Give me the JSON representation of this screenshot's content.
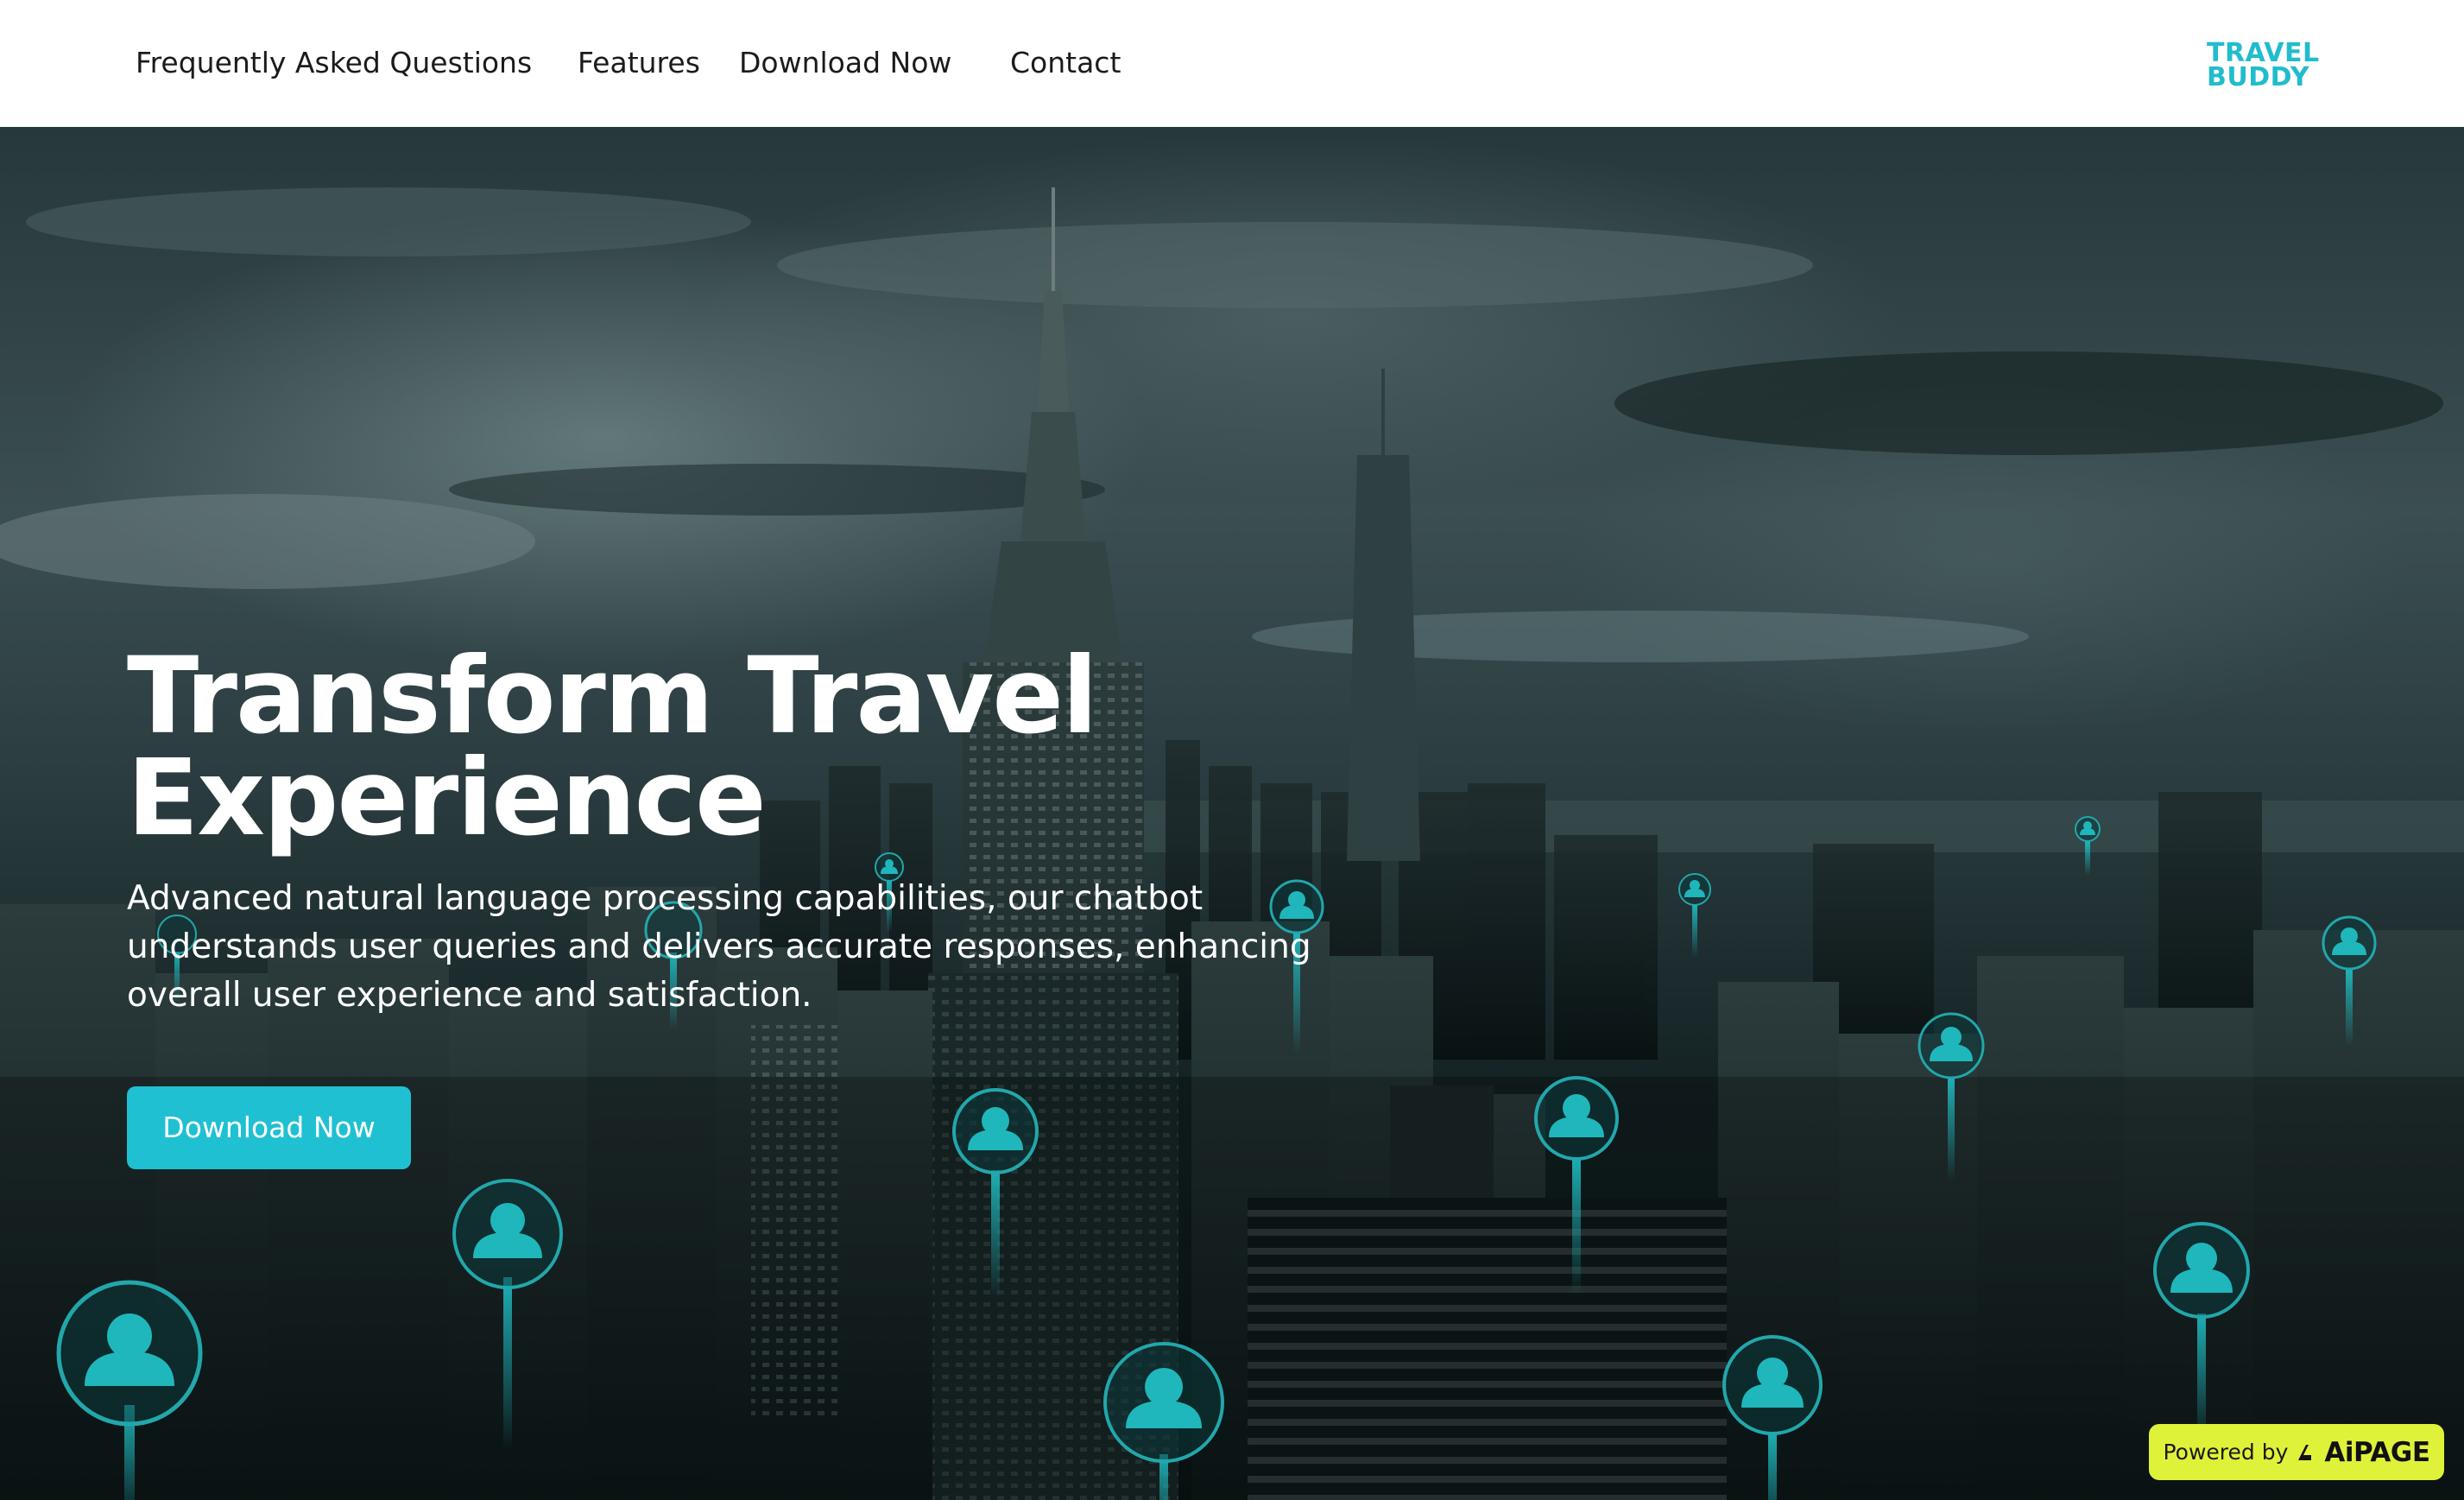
{
  "nav": {
    "items": [
      {
        "label": "Frequently Asked Questions"
      },
      {
        "label": "Features"
      },
      {
        "label": "Download Now"
      },
      {
        "label": "Contact"
      }
    ],
    "logo_line1": "TRAVEL",
    "logo_line2": "BUDDY"
  },
  "hero": {
    "title": "Transform Travel\nExperience",
    "subtitle": "Advanced natural language processing capabilities, our chatbot understands user queries and delivers accurate responses, enhancing overall user experience and satisfaction.",
    "cta_label": "Download Now"
  },
  "badge": {
    "label": "Powered by",
    "brand": "AiPAGE"
  },
  "colors": {
    "accent": "#1fc0d2",
    "logo": "#21bccd",
    "badge_bg": "#dff23a",
    "nav_bg": "#ffffff"
  },
  "icons": [
    "user-pin-icon",
    "aipage-logo-icon"
  ]
}
